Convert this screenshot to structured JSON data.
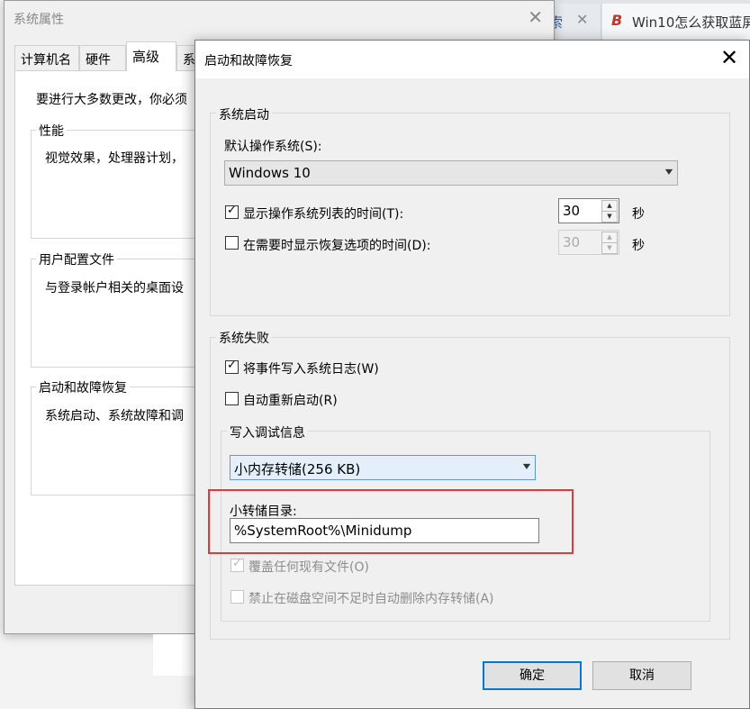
{
  "browser": {
    "tabs": [
      {
        "label": "索",
        "close": "✕"
      },
      {
        "label": "Win10怎么获取蓝屏",
        "logo": "B"
      }
    ]
  },
  "system_properties": {
    "title": "系统属性",
    "close": "✕",
    "tabs": [
      "计算机名",
      "硬件",
      "高级",
      "系"
    ],
    "active_tab": "高级",
    "intro": "要进行大多数更改，你必须",
    "groups": [
      {
        "legend": "性能",
        "text": "视觉效果，处理器计划，"
      },
      {
        "legend": "用户配置文件",
        "text": "与登录帐户相关的桌面设"
      },
      {
        "legend": "启动和故障恢复",
        "text": "系统启动、系统故障和调"
      }
    ]
  },
  "dialog": {
    "title": "启动和故障恢复",
    "close": "✕",
    "startup": {
      "legend": "系统启动",
      "default_os_label": "默认操作系统(S):",
      "default_os_value": "Windows 10",
      "show_list": {
        "label": "显示操作系统列表的时间(T):",
        "checked": true,
        "value": "30",
        "unit": "秒"
      },
      "show_recovery": {
        "label": "在需要时显示恢复选项的时间(D):",
        "checked": false,
        "value": "30",
        "unit": "秒"
      }
    },
    "failure": {
      "legend": "系统失败",
      "write_event": {
        "label": "将事件写入系统日志(W)",
        "checked": true
      },
      "auto_restart": {
        "label": "自动重新启动(R)",
        "checked": false
      },
      "debug": {
        "legend": "写入调试信息",
        "type_value": "小内存转储(256 KB)",
        "dir_label": "小转储目录:",
        "dir_value": "%SystemRoot%\\Minidump",
        "overwrite": {
          "label": "覆盖任何现有文件(O)",
          "checked": true,
          "enabled": false
        },
        "disable_auto_delete": {
          "label": "禁止在磁盘空间不足时自动删除内存转储(A)",
          "checked": false,
          "enabled": false
        }
      }
    },
    "buttons": {
      "ok": "确定",
      "cancel": "取消"
    },
    "check_mark": "✓",
    "arrow_down": "▾",
    "spin_up": "▲",
    "spin_down": "▼"
  },
  "colors": {
    "highlight": "#e03b3b",
    "accent": "#0078d7"
  }
}
